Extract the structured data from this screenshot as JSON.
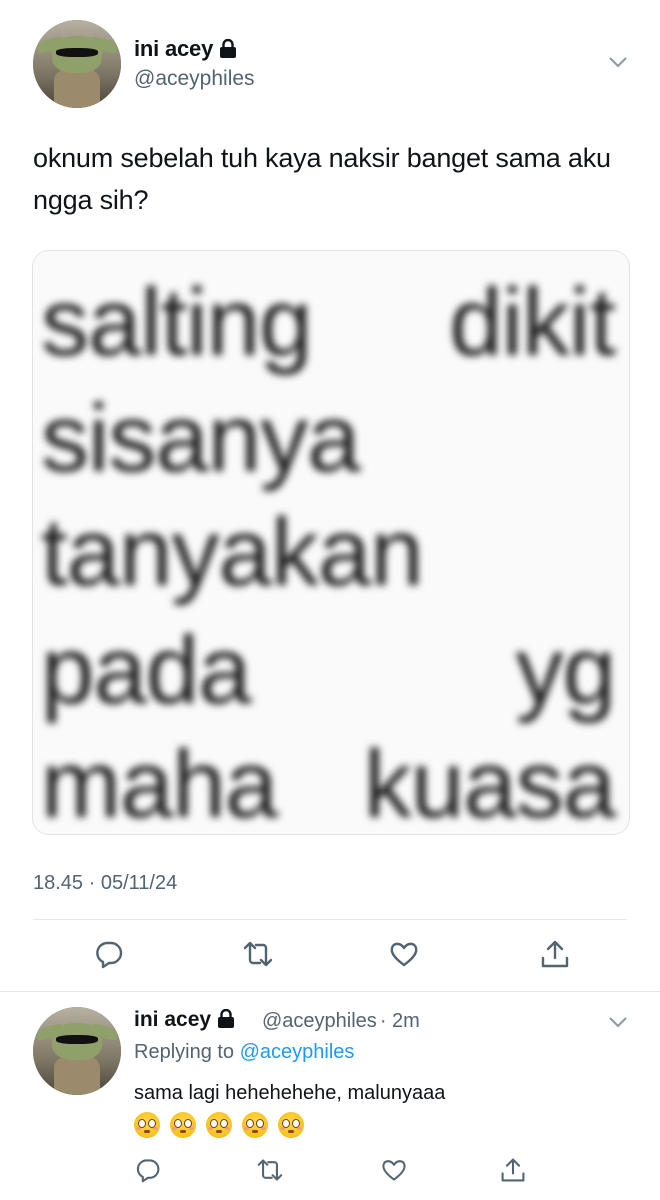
{
  "tweet": {
    "author_name": "ini acey",
    "author_handle": "@aceyphiles",
    "text": "oknum sebelah tuh kaya naksir banget sama aku ngga sih?",
    "media_lines": [
      [
        "salting",
        "dikit"
      ],
      [
        "sisanya"
      ],
      [
        "tanyakan"
      ],
      [
        "pada",
        "yg"
      ],
      [
        "maha",
        "kuasa"
      ]
    ],
    "timestamp": "18.45 · 05/11/24"
  },
  "reply": {
    "author_name": "ini acey",
    "author_handle": "@aceyphiles",
    "age": "· 2m",
    "replying_prefix": "Replying to",
    "replying_handle": "@aceyphiles",
    "text": "sama lagi hehehehehe, malunyaaa",
    "emoji_count": 5
  },
  "icons": {
    "avatar": "baby-yoda-avatar",
    "lock": "lock-icon",
    "menu": "chevron-down-icon",
    "actions": [
      "reply-icon",
      "retweet-icon",
      "like-icon",
      "share-icon"
    ]
  },
  "colors": {
    "text": "#0f1419",
    "secondary": "#536471",
    "link": "#1d9bf0",
    "divider": "#e6e9ec"
  }
}
